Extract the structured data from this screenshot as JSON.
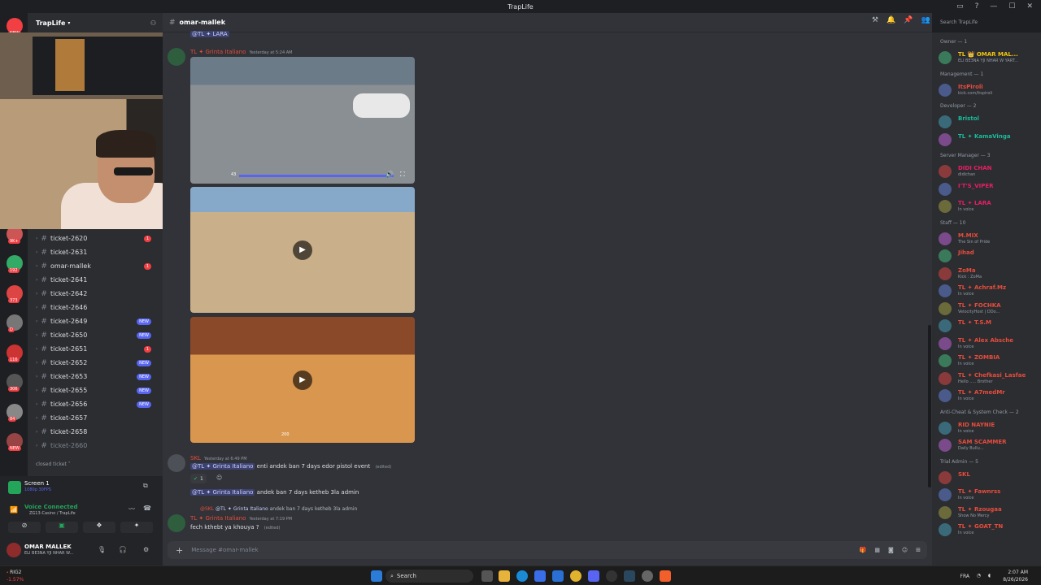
{
  "window": {
    "title": "TrapLife"
  },
  "server": {
    "name": "TrapLife"
  },
  "server_badges": [
    "NEW",
    "1",
    "97",
    "199",
    "637",
    "9K+",
    "1K+",
    "9K+",
    "192",
    "373",
    "D",
    "116",
    "306",
    "84",
    "NEW"
  ],
  "channels": [
    {
      "name": "ticket-2620",
      "badge": "1",
      "badge_type": "red"
    },
    {
      "name": "ticket-2631",
      "badge": "",
      "badge_type": ""
    },
    {
      "name": "omar-mallek",
      "badge": "1",
      "badge_type": "red"
    },
    {
      "name": "ticket-2641",
      "badge": "",
      "badge_type": ""
    },
    {
      "name": "ticket-2642",
      "badge": "",
      "badge_type": ""
    },
    {
      "name": "ticket-2646",
      "badge": "",
      "badge_type": ""
    },
    {
      "name": "ticket-2649",
      "badge": "NEW",
      "badge_type": "new"
    },
    {
      "name": "ticket-2650",
      "badge": "NEW",
      "badge_type": "new"
    },
    {
      "name": "ticket-2651",
      "badge": "1",
      "badge_type": "red"
    },
    {
      "name": "ticket-2652",
      "badge": "NEW",
      "badge_type": "new"
    },
    {
      "name": "ticket-2653",
      "badge": "NEW",
      "badge_type": "new"
    },
    {
      "name": "ticket-2655",
      "badge": "NEW",
      "badge_type": "new"
    },
    {
      "name": "ticket-2656",
      "badge": "NEW",
      "badge_type": "new"
    },
    {
      "name": "ticket-2657",
      "badge": "",
      "badge_type": ""
    },
    {
      "name": "ticket-2658",
      "badge": "",
      "badge_type": ""
    },
    {
      "name": "ticket-2660",
      "badge": "",
      "badge_type": "dim"
    }
  ],
  "closed_category": "closed ticket",
  "voice": {
    "screen_label": "Screen 1",
    "screen_sub": "1080p 30FPS",
    "status": "Voice Connected",
    "channel": "ZG13-Casino / TrapLife"
  },
  "user": {
    "name": "OMAR MALLEK",
    "status": "ELI BE3NA YJI NHAR W..."
  },
  "channel_header": {
    "name": "omar-mallek"
  },
  "search_placeholder": "Search TrapLife",
  "messages": {
    "top_mention": "@TL ✦ LARA",
    "m1": {
      "author": "TL ✦ Grinta Italiano",
      "time": "Yesterday at 5:24 AM",
      "video_time": "43"
    },
    "m2": {
      "author": "SKL",
      "time": "Yesterday at 6:49 PM",
      "line1_mention": "@TL ✦ Grinta Italiano",
      "line1": "enti andek ban 7 days edor pistol event",
      "edited": "(edited)",
      "reaction_count": "1",
      "line2_mention": "@TL ✦ Grinta Italiano",
      "line2": "andek ban 7 days ketheb 3la admin"
    },
    "m3": {
      "reply_author": "@SKL",
      "reply_mention": "@TL ✦ Grinta Italiano",
      "reply_text": "andek ban 7 days ketheb 3la admin",
      "author": "TL ✦ Grinta Italiano",
      "time": "Yesterday at 7:19 PM",
      "text": "fech kthebt ya khouya ?",
      "edited": "(edited)"
    },
    "video3_counter": "200"
  },
  "compose_placeholder": "Message #omar-mallek",
  "members": [
    {
      "type": "role",
      "label": "Owner — 1"
    },
    {
      "type": "member",
      "name": "TL 👑 OMAR MAL...",
      "status": "ELI BE3NA YJI NHAR W YART...",
      "color": "#f1c40f"
    },
    {
      "type": "role",
      "label": "Management — 1"
    },
    {
      "type": "member",
      "name": "ItsPiroli",
      "status": "kick.com/itspiroli",
      "color": "#e74c3c"
    },
    {
      "type": "role",
      "label": "Developer — 2"
    },
    {
      "type": "member",
      "name": "Bristol",
      "status": "",
      "color": "#1abc9c"
    },
    {
      "type": "member",
      "name": "TL ✦ KamaVinga",
      "status": "",
      "color": "#1abc9c"
    },
    {
      "type": "role",
      "label": "Server Manager — 3"
    },
    {
      "type": "member",
      "name": "DIDI CHAN",
      "status": "didichan",
      "color": "#e91e63"
    },
    {
      "type": "member",
      "name": "I'T'S_VIPER",
      "status": "",
      "color": "#e91e63"
    },
    {
      "type": "member",
      "name": "TL ✦ LARA",
      "status": "In voice",
      "color": "#e91e63"
    },
    {
      "type": "role",
      "label": "Staff — 10"
    },
    {
      "type": "member",
      "name": "M.MIX",
      "status": "The Sin of Pride",
      "color": "#e74c3c"
    },
    {
      "type": "member",
      "name": "Jihad",
      "status": "",
      "color": "#e74c3c"
    },
    {
      "type": "member",
      "name": "ZoMa",
      "status": "Kick : ZoMa",
      "color": "#e74c3c"
    },
    {
      "type": "member",
      "name": "TL ✦ Achraf.Mz",
      "status": "In voice",
      "color": "#e74c3c"
    },
    {
      "type": "member",
      "name": "TL ✦ FOCHKA",
      "status": "VelocityHost | DDo...",
      "color": "#e74c3c"
    },
    {
      "type": "member",
      "name": "TL ✦ T.S.M",
      "status": "",
      "color": "#e74c3c"
    },
    {
      "type": "member",
      "name": "TL ✦ Alex Absche",
      "status": "In voice",
      "color": "#e74c3c"
    },
    {
      "type": "member",
      "name": "TL ✦ ZOMBIA",
      "status": "In voice",
      "color": "#e74c3c"
    },
    {
      "type": "member",
      "name": "TL ✦ Chefkasi_Lasfae",
      "status": "Hello ..... Brother",
      "color": "#e74c3c"
    },
    {
      "type": "member",
      "name": "TL ✦ A7medMr",
      "status": "In voice",
      "color": "#e74c3c"
    },
    {
      "type": "role",
      "label": "Anti-Cheat & System Check — 2"
    },
    {
      "type": "member",
      "name": "RID NAYNIE",
      "status": "In voice",
      "color": "#e74c3c"
    },
    {
      "type": "member",
      "name": "SAM SCAMMER",
      "status": "Daily Bullu...",
      "color": "#e74c3c"
    },
    {
      "type": "role",
      "label": "Trial Admin — 5"
    },
    {
      "type": "member",
      "name": "SKL",
      "status": "",
      "color": "#e74c3c"
    },
    {
      "type": "member",
      "name": "TL ✦ Fawnrss",
      "status": "In voice",
      "color": "#e74c3c"
    },
    {
      "type": "member",
      "name": "TL ✦ Rzougaa",
      "status": "Show No Mercy",
      "color": "#e74c3c"
    },
    {
      "type": "member",
      "name": "TL ✦ GOAT_TN",
      "status": "In voice",
      "color": "#e74c3c"
    }
  ],
  "taskbar": {
    "search": "Search",
    "weather": "RIG2",
    "weather_sub": "-1.57%",
    "lang": "FRA",
    "time": "2:07 AM",
    "date": "8/26/2026"
  },
  "colors": {
    "blurple": "#5865f2",
    "red": "#f23f43",
    "green": "#23a55a"
  }
}
